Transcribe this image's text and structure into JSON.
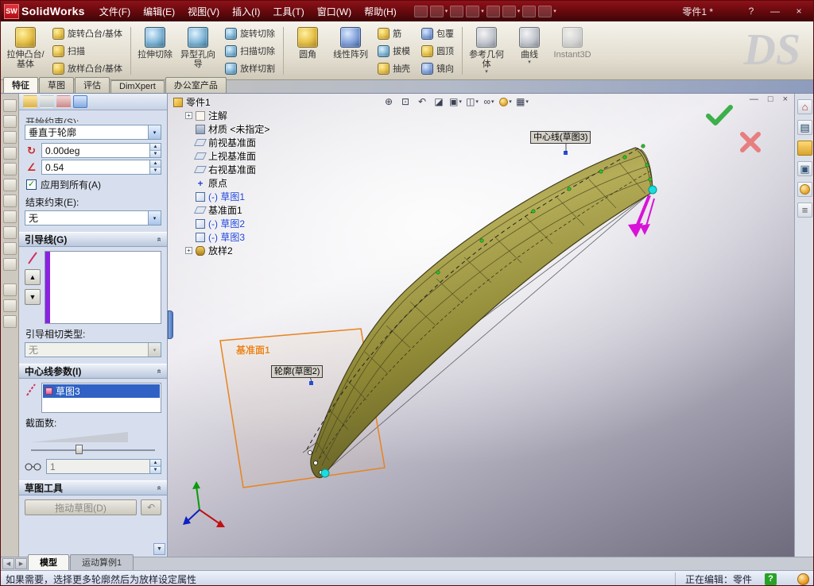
{
  "titlebar": {
    "badge": "SW",
    "app_name": "SolidWorks",
    "menus": [
      "文件(F)",
      "编辑(E)",
      "视图(V)",
      "插入(I)",
      "工具(T)",
      "窗口(W)",
      "帮助(H)"
    ],
    "doc_title": "零件1 *"
  },
  "icons": {
    "dropdown": "▾",
    "up": "▲",
    "down": "▼",
    "zoom_fit": "⊕",
    "zoom_area": "⊡",
    "prev_view": "↶",
    "section": "◪",
    "orientation": "▣",
    "display_style": "◫",
    "hide_show": "∞",
    "scene": "▦",
    "min": "—",
    "restore": "□",
    "close": "×",
    "help": "?",
    "undo": "↶",
    "home": "⌂",
    "library": "▤",
    "palette": "▣",
    "props": "≡",
    "chev": "«",
    "angle": "∠",
    "rotate": "↻",
    "nav_left": "◀",
    "nav_right": "▶",
    "check": "✓"
  },
  "ribbon": {
    "items": [
      "拉伸凸台/基体",
      "旋转凸台/基体",
      "扫描",
      "放样凸台/基体",
      "拉伸切除",
      "异型孔向导",
      "旋转切除",
      "扫描切除",
      "放样切割",
      "圆角",
      "线性阵列",
      "筋",
      "拔模",
      "抽壳",
      "包覆",
      "圆顶",
      "镜向",
      "参考几何体",
      "曲线",
      "Instant3D"
    ],
    "watermark": "DS"
  },
  "command_tabs": [
    "特征",
    "草图",
    "评估",
    "DimXpert",
    "办公室产品"
  ],
  "panel": {
    "start_constraint_label": "开始约束(S):",
    "start_constraint_value": "垂直于轮廓",
    "angle_value": "0.00deg",
    "tangent_length_value": "0.54",
    "apply_to_all_label": "应用到所有(A)",
    "end_constraint_label": "结束约束(E):",
    "end_constraint_value": "无",
    "guide_lines_header": "引导线(G)",
    "guide_tangency_label": "引导相切类型:",
    "guide_tangency_value": "无",
    "centerline_header": "中心线参数(I)",
    "centerline_item": "草图3",
    "sections_label": "截面数:",
    "sections_value": "1",
    "sketch_tools_header": "草图工具",
    "drag_sketch_label": "拖动草图(D)"
  },
  "tree": {
    "root": "零件1",
    "items": [
      {
        "label": "注解",
        "expand": "+"
      },
      {
        "label": "材质 <未指定>",
        "expand": ""
      },
      {
        "label": "前视基准面",
        "expand": ""
      },
      {
        "label": "上视基准面",
        "expand": ""
      },
      {
        "label": "右视基准面",
        "expand": ""
      },
      {
        "label": "原点",
        "expand": ""
      },
      {
        "label": "(-) 草图1",
        "expand": ""
      },
      {
        "label": "基准面1",
        "expand": ""
      },
      {
        "label": "(-) 草图2",
        "expand": ""
      },
      {
        "label": "(-) 草图3",
        "expand": ""
      },
      {
        "label": "放样2",
        "expand": "+"
      }
    ]
  },
  "viewport": {
    "centerline_label": "中心线(草图3)",
    "profile_label": "轮廓(草图2)",
    "plane_label": "基准面1"
  },
  "bottom_tabs": [
    "模型",
    "运动算例1"
  ],
  "statusbar": {
    "message": "如果需要，选择更多轮廓然后为放样设定属性",
    "editing": "正在编辑：零件"
  }
}
